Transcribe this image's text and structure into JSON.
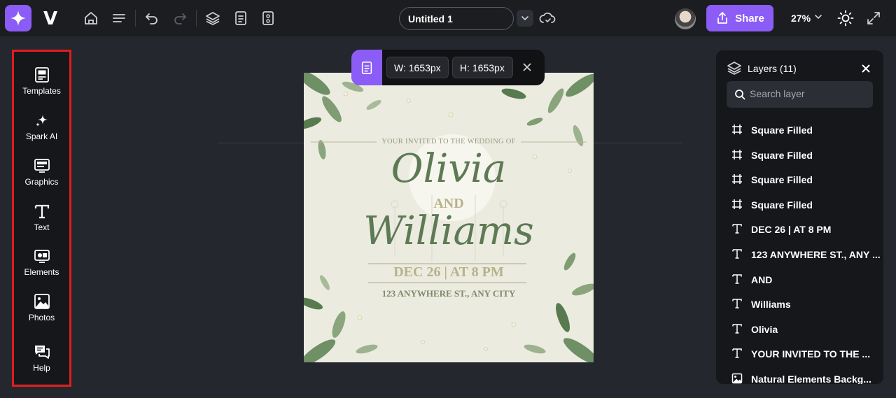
{
  "toolbar": {
    "logo_letter": "V",
    "document_title": "Untitled 1",
    "share_label": "Share",
    "zoom_level": "27%"
  },
  "sidebar": {
    "items": [
      {
        "label": "Templates",
        "icon": "templates-icon"
      },
      {
        "label": "Spark AI",
        "icon": "sparkle-icon"
      },
      {
        "label": "Graphics",
        "icon": "graphics-icon"
      },
      {
        "label": "Text",
        "icon": "text-icon"
      },
      {
        "label": "Elements",
        "icon": "elements-icon"
      },
      {
        "label": "Photos",
        "icon": "photo-icon"
      },
      {
        "label": "Help",
        "icon": "chat-icon"
      }
    ]
  },
  "canvas_toolbar": {
    "width_label": "W: 1653px",
    "height_label": "H: 1653px"
  },
  "design": {
    "invite_line": "YOUR INVITED TO THE WEDDING OF",
    "name1": "Olivia",
    "and": "AND",
    "name2": "Williams",
    "date": "DEC 26 | AT 8 PM",
    "address": "123 ANYWHERE ST., ANY CITY",
    "text_color": "#5d7a55",
    "background_color": "#ecebe0"
  },
  "layers": {
    "title": "Layers (11)",
    "search_placeholder": "Search layer",
    "items": [
      {
        "name": "Square Filled",
        "icon": "frame-icon"
      },
      {
        "name": "Square Filled",
        "icon": "frame-icon"
      },
      {
        "name": "Square Filled",
        "icon": "frame-icon"
      },
      {
        "name": "Square Filled",
        "icon": "frame-icon"
      },
      {
        "name": "DEC 26 | AT 8 PM",
        "icon": "text-icon"
      },
      {
        "name": "123 ANYWHERE ST., ANY ...",
        "icon": "text-icon"
      },
      {
        "name": "AND",
        "icon": "text-icon"
      },
      {
        "name": "Williams",
        "icon": "text-icon"
      },
      {
        "name": "Olivia",
        "icon": "text-icon"
      },
      {
        "name": "YOUR INVITED TO THE ...",
        "icon": "text-icon"
      },
      {
        "name": "Natural Elements Backg...",
        "icon": "image-icon"
      }
    ]
  },
  "colors": {
    "accent": "#8b5cf6",
    "highlight_outline": "#e21c1c"
  }
}
